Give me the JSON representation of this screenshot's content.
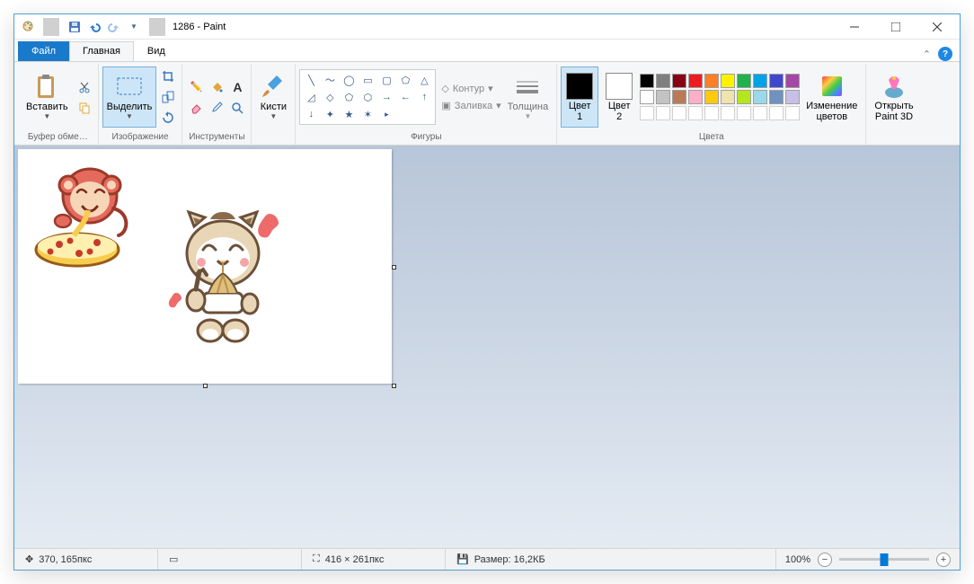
{
  "title": "1286 - Paint",
  "tabs": {
    "file": "Файл",
    "home": "Главная",
    "view": "Вид"
  },
  "groups": {
    "clipboard": {
      "label": "Буфер обме…",
      "paste": "Вставить"
    },
    "image": {
      "label": "Изображение",
      "select": "Выделить"
    },
    "tools": {
      "label": "Инструменты"
    },
    "brushes": {
      "label": "Кисти",
      "brush": "Кисти"
    },
    "shapes": {
      "label": "Фигуры",
      "outline": "Контур",
      "fill": "Заливка",
      "thickness": "Толщина"
    },
    "colors": {
      "label": "Цвета",
      "c1": "Цвет\n1",
      "c2": "Цвет\n2",
      "edit": "Изменение\nцветов"
    },
    "p3d": {
      "label": "",
      "open": "Открыть\nPaint 3D"
    }
  },
  "palette_row1": [
    "#000000",
    "#7f7f7f",
    "#880015",
    "#ed1c24",
    "#ff7f27",
    "#fff200",
    "#22b14c",
    "#00a2e8",
    "#3f48cc",
    "#a349a4"
  ],
  "palette_row2": [
    "#ffffff",
    "#c3c3c3",
    "#b97a57",
    "#ffaec9",
    "#ffc90e",
    "#efe4b0",
    "#b5e61d",
    "#99d9ea",
    "#7092be",
    "#c8bfe7"
  ],
  "palette_row3": [
    "",
    "",
    "",
    "",
    "",
    "",
    "",
    "",
    "",
    ""
  ],
  "color1": "#000000",
  "color2": "#ffffff",
  "status": {
    "cursor": "370, 165пкс",
    "dims": "416 × 261пкс",
    "size": "Размер: 16,2КБ",
    "zoom": "100%"
  }
}
